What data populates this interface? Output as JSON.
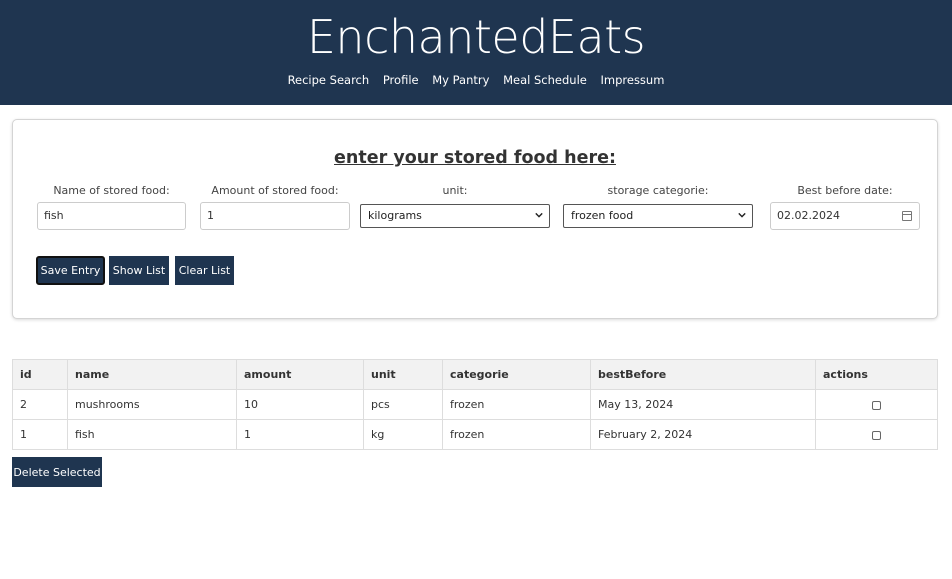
{
  "header": {
    "title": "EnchantedEats",
    "nav": [
      "Recipe Search",
      "Profile",
      "My Pantry",
      "Meal Schedule",
      "Impressum"
    ]
  },
  "form": {
    "heading": "enter your stored food here:",
    "fields": {
      "name": {
        "label": "Name of stored food:",
        "value": "fish"
      },
      "amount": {
        "label": "Amount of stored food:",
        "value": "1"
      },
      "unit": {
        "label": "unit:",
        "value": "kilograms"
      },
      "category": {
        "label": "storage categorie:",
        "value": "frozen food"
      },
      "best_before": {
        "label": "Best before date:",
        "value": "02.02.2024"
      }
    },
    "buttons": {
      "save": "Save Entry",
      "show": "Show List",
      "clear": "Clear List"
    }
  },
  "table": {
    "headers": [
      "id",
      "name",
      "amount",
      "unit",
      "categorie",
      "bestBefore",
      "actions"
    ],
    "rows": [
      {
        "id": "2",
        "name": "mushrooms",
        "amount": "10",
        "unit": "pcs",
        "categorie": "frozen",
        "bestBefore": "May 13, 2024",
        "checked": false
      },
      {
        "id": "1",
        "name": "fish",
        "amount": "1",
        "unit": "kg",
        "categorie": "frozen",
        "bestBefore": "February 2, 2024",
        "checked": false
      }
    ]
  },
  "delete_button": "Delete Selected",
  "colors": {
    "brand": "#1f3550",
    "header_text": "#ffffff",
    "table_header_bg": "#f2f2f2"
  }
}
